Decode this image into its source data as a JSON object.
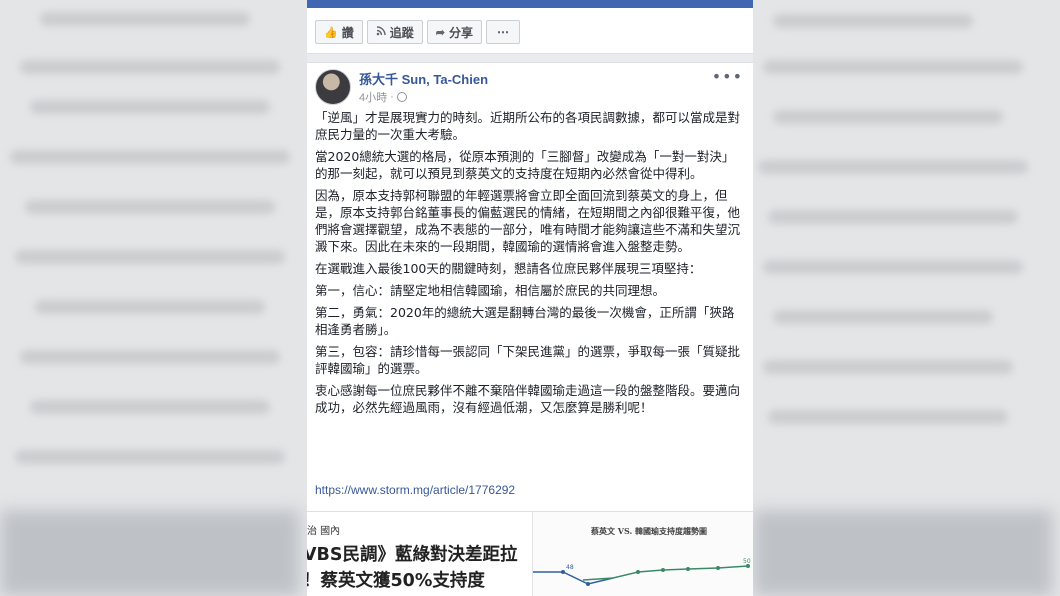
{
  "actions": [
    {
      "icon": "thumbs-up-icon",
      "glyph": "👍",
      "label": "讚"
    },
    {
      "icon": "rss-icon",
      "glyph": "⌗",
      "label": "追蹤"
    },
    {
      "icon": "share-arrow-icon",
      "glyph": "➦",
      "label": "分享"
    },
    {
      "icon": "more-icon",
      "glyph": "",
      "label": "⋯"
    }
  ],
  "post": {
    "author": "孫大千 Sun, Ta-Chien",
    "time": "4小時",
    "menu": "•••",
    "paragraphs": [
      "「逆風」才是展現實力的時刻。近期所公布的各項民調數據，都可以當成是對庶民力量的一次重大考驗。",
      "當2020總統大選的格局，從原本預測的「三腳督」改變成為「一對一對決」的那一刻起，就可以預見到蔡英文的支持度在短期內必然會從中得利。",
      "因為，原本支持郭柯聯盟的年輕選票將會立即全面回流到蔡英文的身上，但是，原本支持郭台銘董事長的偏藍選民的情緒，在短期間之內卻很難平復，他們將會選擇觀望，成為不表態的一部分，唯有時間才能夠讓這些不滿和失望沉澱下來。因此在未來的一段期間，韓國瑜的選情將會進入盤整走勢。",
      "在選戰進入最後100天的關鍵時刻，懇請各位庶民夥伴展現三項堅持：",
      "第一，信心：請堅定地相信韓國瑜，相信屬於庶民的共同理想。",
      "第二，勇氣：2020年的總統大選是翻轉台灣的最後一次機會，正所謂「狹路相逢勇者勝」。",
      "第三，包容：請珍惜每一張認同「下架民進黨」的選票，爭取每一張「質疑批評韓國瑜」的選票。",
      "衷心感謝每一位庶民夥伴不離不棄陪伴韓國瑜走過這一段的盤整階段。要邁向成功，必然先經過風雨，沒有經過低潮，又怎麼算是勝利呢！"
    ],
    "link": "https://www.storm.mg/article/1776292"
  },
  "preview": {
    "category": "治 國內",
    "headline_line1": "VBS民調》藍綠對決差距拉",
    "headline_line2": "！蔡英文獲50%支持度",
    "chart_title": "蔡英文 VS. 韓國瑜支持度趨勢圖",
    "chart_label_left": "48",
    "chart_label_right": "50"
  },
  "colors": {
    "facebook_blue": "#4267b2",
    "author_link": "#365899",
    "url_link": "#385898",
    "series_green": "#3a8a6a",
    "series_blue": "#2e5e9e"
  }
}
